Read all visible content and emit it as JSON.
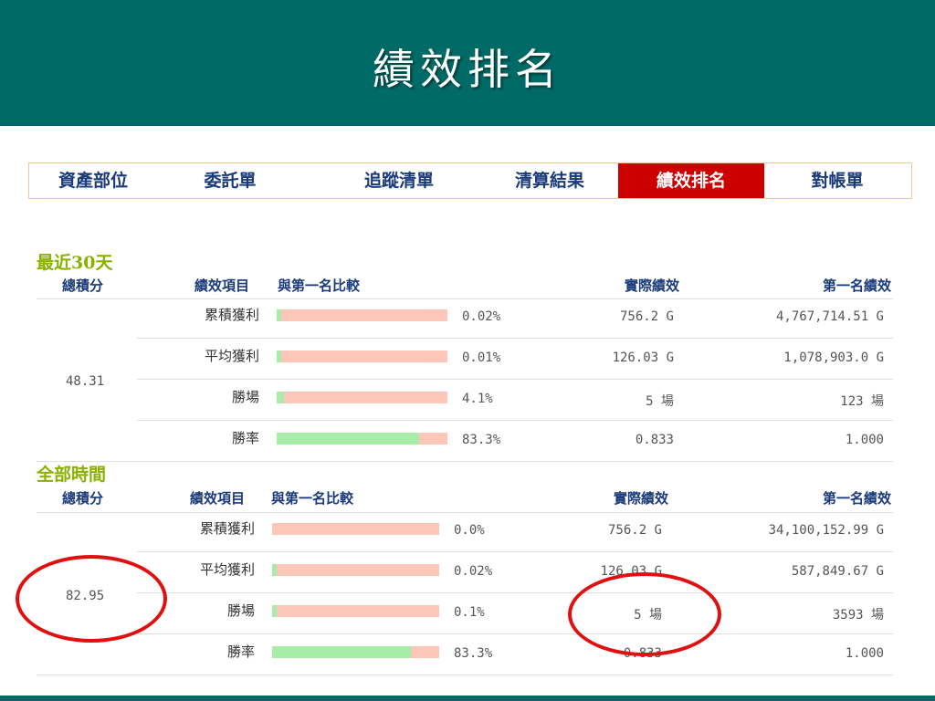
{
  "header": {
    "title": "績效排名",
    "color": "#006a66"
  },
  "tabs": [
    {
      "label": "資產部位",
      "active": false
    },
    {
      "label": "委託單",
      "active": false
    },
    {
      "label": "追蹤清單",
      "active": false
    },
    {
      "label": "清算結果",
      "active": false
    },
    {
      "label": "績效排名",
      "active": true
    },
    {
      "label": "對帳單",
      "active": false
    }
  ],
  "columns": {
    "total_score": "總積分",
    "item": "績效項目",
    "compare": "與第一名比較",
    "actual": "實際績效",
    "first": "第一名績效"
  },
  "sections": [
    {
      "label": "最近30天",
      "total_score": "48.31",
      "rows": [
        {
          "item": "累積獲利",
          "ratio": 0.0002,
          "pct": "0.02%",
          "actual": "756.2 G",
          "first": "4,767,714.51 G"
        },
        {
          "item": "平均獲利",
          "ratio": 0.0001,
          "pct": "0.01%",
          "actual": "126.03 G",
          "first": "1,078,903.0 G"
        },
        {
          "item": "勝場",
          "ratio": 0.041,
          "pct": "4.1%",
          "actual": "5 場",
          "first": "123 場"
        },
        {
          "item": "勝率",
          "ratio": 0.833,
          "pct": "83.3%",
          "actual": "0.833",
          "first": "1.000"
        }
      ]
    },
    {
      "label": "全部時間",
      "total_score": "82.95",
      "rows": [
        {
          "item": "累積獲利",
          "ratio": 0.0,
          "pct": "0.0%",
          "actual": "756.2 G",
          "first": "34,100,152.99 G"
        },
        {
          "item": "平均獲利",
          "ratio": 0.0002,
          "pct": "0.02%",
          "actual": "126.03 G",
          "first": "587,849.67 G"
        },
        {
          "item": "勝場",
          "ratio": 0.001,
          "pct": "0.1%",
          "actual": "5 場",
          "first": "3593 場"
        },
        {
          "item": "勝率",
          "ratio": 0.833,
          "pct": "83.3%",
          "actual": "0.833",
          "first": "1.000"
        }
      ]
    }
  ],
  "colors": {
    "tab_active": "#cc0000",
    "bar_bg": "#fcc7b8",
    "bar_fill": "#a8ecaa",
    "section_label": "#8ab000",
    "highlight_ring": "#e01010"
  }
}
